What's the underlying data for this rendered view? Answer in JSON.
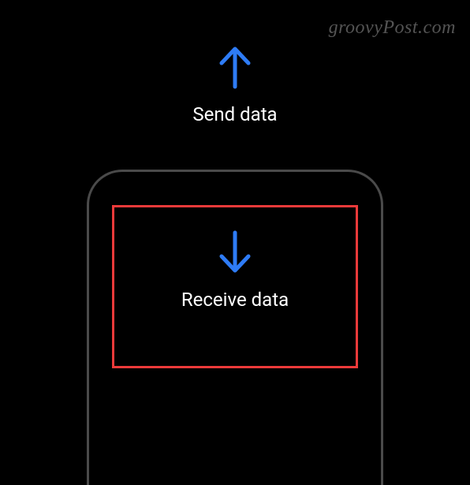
{
  "watermark": "groovyPost.com",
  "send": {
    "label": "Send data"
  },
  "receive": {
    "label": "Receive data"
  },
  "colors": {
    "accent": "#2e7cf6",
    "highlight": "#ee3a3a"
  }
}
